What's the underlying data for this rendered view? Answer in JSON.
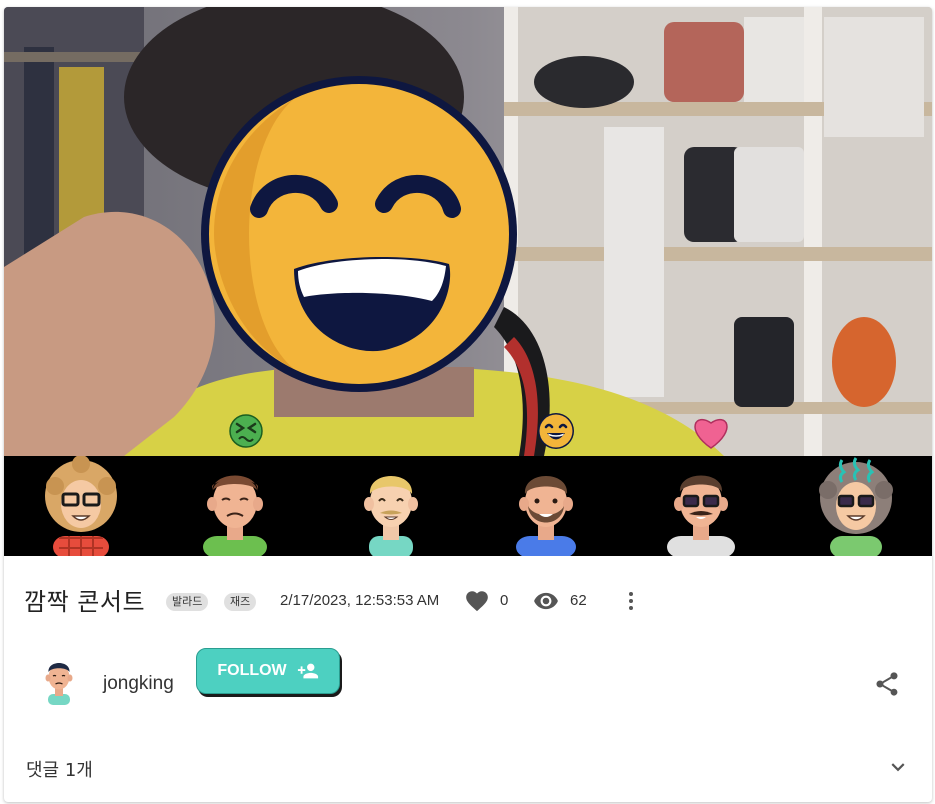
{
  "post": {
    "title": "깜짝 콘서트",
    "tags": [
      "발라드",
      "재즈"
    ],
    "datetime": "2/17/2023, 12:53:53 AM",
    "likes": "0",
    "views": "62"
  },
  "user": {
    "name": "jongking",
    "follow_label": "FOLLOW"
  },
  "comments": {
    "label": "댓글 1개"
  },
  "colors": {
    "follow_bg": "#4dd0c1",
    "emoji_yellow": "#f3b53a",
    "heart": "#f06292"
  },
  "icons": {
    "like": "heart-icon",
    "views": "eye-icon",
    "menu": "more-vert-icon",
    "follow": "person-add-icon",
    "share": "share-icon",
    "expand": "chevron-down-icon"
  }
}
